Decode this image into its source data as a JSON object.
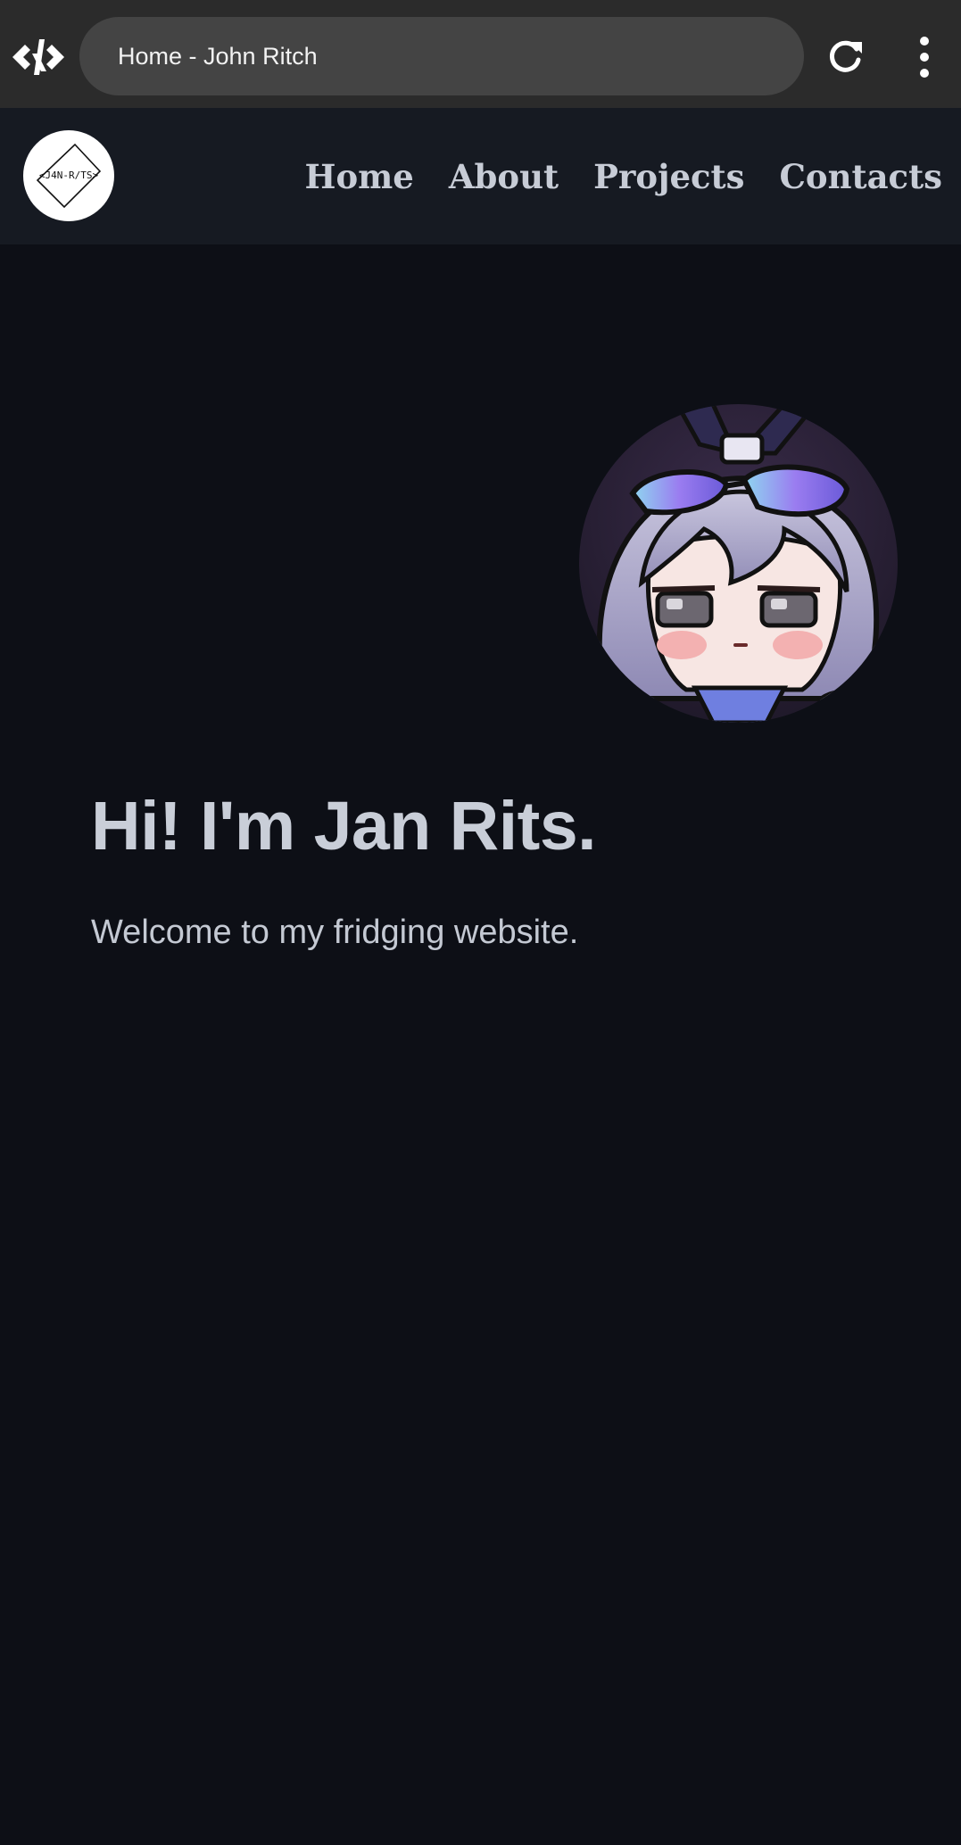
{
  "browser": {
    "app_icon": "code-brackets-icon",
    "tab_title": "Home - John Ritch",
    "reload_icon": "reload-icon",
    "menu_icon": "kebab-menu-icon"
  },
  "site": {
    "logo_text": "<J4N-R/TS>",
    "nav": [
      {
        "label": "Home"
      },
      {
        "label": "About"
      },
      {
        "label": "Projects"
      },
      {
        "label": "Contacts"
      }
    ]
  },
  "hero": {
    "avatar": "anime-avatar-image",
    "title": "Hi! I'm Jan Rits.",
    "subtitle": "Welcome to my fridging website."
  },
  "colors": {
    "page_bg": "#0d0f16",
    "header_bg": "#161a22",
    "browser_bar": "#2b2b2b",
    "text": "#c9ced8"
  }
}
